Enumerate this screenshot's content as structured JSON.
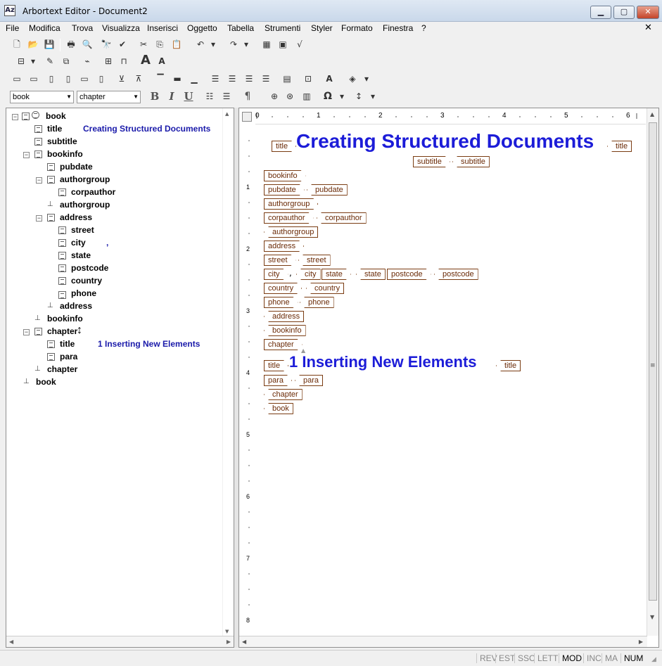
{
  "window": {
    "title": "Arbortext Editor - Document2",
    "app_icon": "Az"
  },
  "menu": [
    "File",
    "Modifica",
    "Trova",
    "Visualizza",
    "Inserisci",
    "Oggetto",
    "Tabella",
    "Strumenti",
    "Styler",
    "Formato",
    "Finestra",
    "?"
  ],
  "toolbar": {
    "element_combo": "book",
    "context_combo": "chapter",
    "bold": "B",
    "italic": "I",
    "underline": "U",
    "pilcrow": "¶",
    "omega": "Ω"
  },
  "tree": {
    "book": "book",
    "title": "title",
    "title_content": "Creating Structured Documents",
    "subtitle": "subtitle",
    "bookinfo": "bookinfo",
    "pubdate": "pubdate",
    "authorgroup": "authorgroup",
    "corpauthor": "corpauthor",
    "address": "address",
    "street": "street",
    "city": "city",
    "city_content": ",",
    "state": "state",
    "postcode": "postcode",
    "country": "country",
    "phone": "phone",
    "chapter": "chapter",
    "chapter_title_content": "1 Inserting New Elements",
    "para": "para"
  },
  "document": {
    "title": "Creating Structured Documents",
    "chapter_title": "1 Inserting New Elements",
    "comma": ","
  },
  "ruler_numbers": [
    "0",
    "1",
    "2",
    "3",
    "4",
    "5",
    "6"
  ],
  "ruler_v_numbers": [
    "1",
    "2",
    "3",
    "4",
    "5",
    "6",
    "7",
    "8"
  ],
  "status": [
    "REV",
    "EST",
    "SSC",
    "LETT",
    "MOD",
    "INC",
    "MA",
    "NUM"
  ],
  "colors": {
    "tag_border": "#7a3c12",
    "content_blue": "#1c1cd8"
  }
}
